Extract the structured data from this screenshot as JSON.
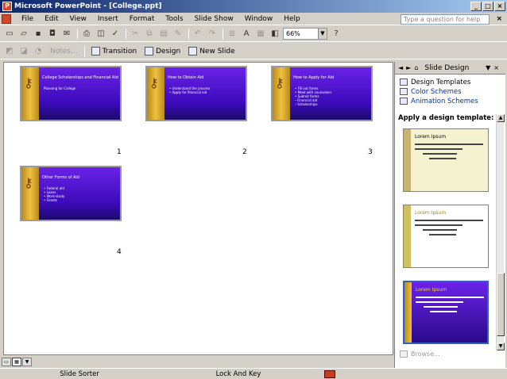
{
  "window": {
    "title": "Microsoft PowerPoint - [College.ppt]"
  },
  "menu": [
    "File",
    "Edit",
    "View",
    "Insert",
    "Format",
    "Tools",
    "Slide Show",
    "Window",
    "Help"
  ],
  "ask_placeholder": "Type a question for help",
  "zoom": "66%",
  "toolbar2": {
    "notes": "Notes...",
    "transition": "Transition",
    "design": "Design",
    "new_slide": "New Slide"
  },
  "slides": [
    {
      "num": "1",
      "title": "College Scholarships and Financial Aid",
      "body": [
        "Planning for College"
      ]
    },
    {
      "num": "2",
      "title": "How to Obtain Aid",
      "body": [
        "• Understand the process",
        "• Apply for financial aid"
      ]
    },
    {
      "num": "3",
      "title": "How to Apply for Aid",
      "body": [
        "• Fill out forms",
        "• Meet with counselors",
        "• Submit forms",
        "   – Financial aid",
        "   – Scholarships"
      ]
    },
    {
      "num": "4",
      "title": "Other Forms of Aid",
      "body": [
        "• Federal aid",
        "• Loans",
        "• Work-study",
        "• Grants"
      ]
    }
  ],
  "pane": {
    "title": "Slide Design",
    "links": [
      "Design Templates",
      "Color Schemes",
      "Animation Schemes"
    ],
    "apply_heading": "Apply a design template:",
    "templates": [
      {
        "title": "Lorem Ipsum"
      },
      {
        "title": "Lorem Ipsum"
      },
      {
        "title": "Lorem Ipsum"
      }
    ],
    "browse": "Browse..."
  },
  "status": {
    "view": "Slide Sorter",
    "template": "Lock And Key"
  }
}
